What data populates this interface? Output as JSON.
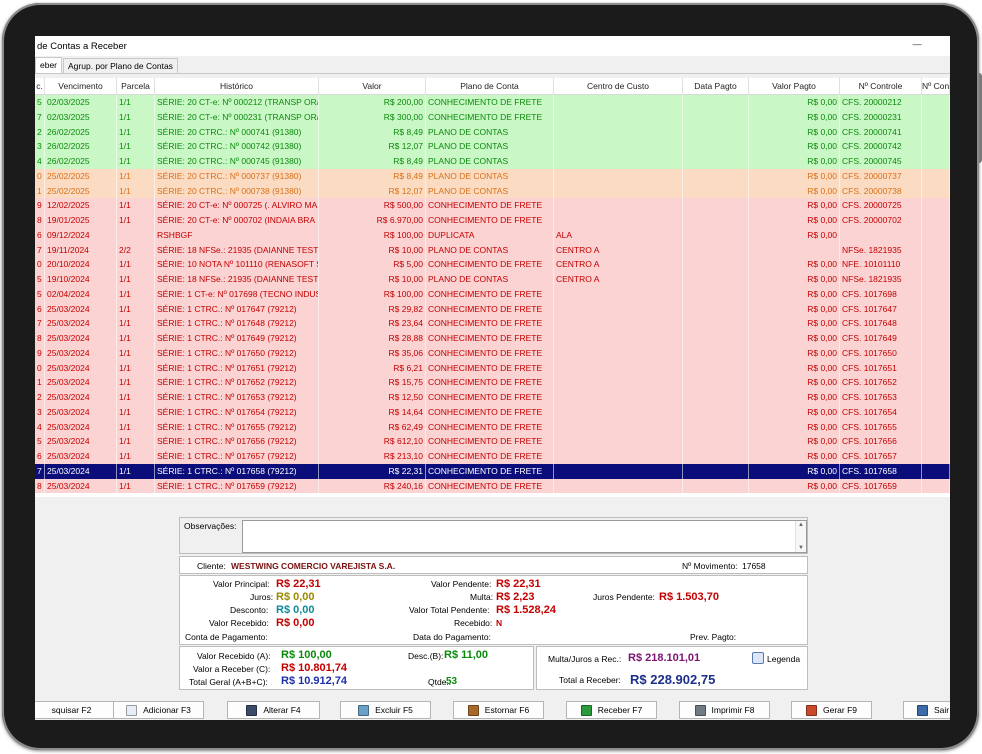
{
  "window": {
    "title": "de Contas a Receber",
    "minimize_glyph": "—"
  },
  "tabs": [
    {
      "label": "eber"
    },
    {
      "label": "Agrup. por Plano de Contas"
    }
  ],
  "columns": [
    "c.",
    "Vencimento",
    "Parcela",
    "Histórico",
    "Valor",
    "Plano de Conta",
    "Centro de Custo",
    "Data Pagto",
    "Valor Pagto",
    "Nº Controle",
    "Nº Contr"
  ],
  "rows": [
    {
      "status": "green",
      "cols": [
        "5",
        "02/03/2025",
        "1/1",
        "SÉRIE: 20 CT-e: Nº 000212 (TRANSP OR/",
        "R$ 200,00",
        "CONHECIMENTO DE FRETE",
        "",
        "",
        "R$ 0,00",
        "CFS. 20000212",
        ""
      ]
    },
    {
      "status": "green",
      "cols": [
        "7",
        "02/03/2025",
        "1/1",
        "SÉRIE: 20 CT-e: Nº 000231 (TRANSP OR/",
        "R$ 300,00",
        "CONHECIMENTO DE FRETE",
        "",
        "",
        "R$ 0,00",
        "CFS. 20000231",
        ""
      ]
    },
    {
      "status": "green",
      "cols": [
        "2",
        "26/02/2025",
        "1/1",
        "SÉRIE: 20 CTRC.: Nº 000741 (91380)",
        "R$ 8,49",
        "PLANO DE CONTAS",
        "",
        "",
        "R$ 0,00",
        "CFS. 20000741",
        ""
      ]
    },
    {
      "status": "green",
      "cols": [
        "3",
        "26/02/2025",
        "1/1",
        "SÉRIE: 20 CTRC.: Nº 000742 (91380)",
        "R$ 12,07",
        "PLANO DE CONTAS",
        "",
        "",
        "R$ 0,00",
        "CFS. 20000742",
        ""
      ]
    },
    {
      "status": "green",
      "cols": [
        "4",
        "26/02/2025",
        "1/1",
        "SÉRIE: 20 CTRC.: Nº 000745 (91380)",
        "R$ 8,49",
        "PLANO DE CONTAS",
        "",
        "",
        "R$ 0,00",
        "CFS. 20000745",
        ""
      ]
    },
    {
      "status": "orange",
      "cols": [
        "0",
        "25/02/2025",
        "1/1",
        "SÉRIE: 20 CTRC.: Nº 000737 (91380)",
        "R$ 8,49",
        "PLANO DE CONTAS",
        "",
        "",
        "R$ 0,00",
        "CFS. 20000737",
        ""
      ]
    },
    {
      "status": "orange",
      "cols": [
        "1",
        "25/02/2025",
        "1/1",
        "SÉRIE: 20 CTRC.: Nº 000738 (91380)",
        "R$ 12,07",
        "PLANO DE CONTAS",
        "",
        "",
        "R$ 0,00",
        "CFS. 20000738",
        ""
      ]
    },
    {
      "status": "red",
      "cols": [
        "9",
        "12/02/2025",
        "1/1",
        "SÉRIE: 20 CT-e: Nº 000725 (. ALVIRO MA",
        "R$ 500,00",
        "CONHECIMENTO DE FRETE",
        "",
        "",
        "R$ 0,00",
        "CFS. 20000725",
        ""
      ]
    },
    {
      "status": "red",
      "cols": [
        "8",
        "19/01/2025",
        "1/1",
        "SÉRIE: 20 CT-e: Nº 000702 (INDAIA BRA",
        "R$ 6.970,00",
        "CONHECIMENTO DE FRETE",
        "",
        "",
        "R$ 0,00",
        "CFS. 20000702",
        ""
      ]
    },
    {
      "status": "red",
      "cols": [
        "6",
        "09/12/2024",
        "",
        "RSHBGF",
        "R$ 100,00",
        "DUPLICATA",
        "ALA",
        "",
        "R$ 0,00",
        "",
        ""
      ]
    },
    {
      "status": "red",
      "cols": [
        "7",
        "19/11/2024",
        "2/2",
        "SÉRIE: 18 NFSe.: 21935 (DAIANNE TESTI",
        "R$ 10,00",
        "PLANO DE CONTAS",
        "CENTRO A",
        "",
        "",
        "NFSe. 1821935",
        ""
      ]
    },
    {
      "status": "red",
      "cols": [
        "0",
        "20/10/2024",
        "1/1",
        "SÉRIE: 10 NOTA Nº 101110 (RENASOFT S",
        "R$ 5,00",
        "CONHECIMENTO DE FRETE",
        "CENTRO A",
        "",
        "R$ 0,00",
        "NFE. 10101110",
        ""
      ]
    },
    {
      "status": "red",
      "cols": [
        "5",
        "19/10/2024",
        "1/1",
        "SÉRIE: 18 NFSe.: 21935 (DAIANNE TESTI",
        "R$ 10,00",
        "PLANO DE CONTAS",
        "CENTRO A",
        "",
        "R$ 0,00",
        "NFSe. 1821935",
        ""
      ]
    },
    {
      "status": "red",
      "cols": [
        "5",
        "02/04/2024",
        "1/1",
        "SÉRIE: 1 CT-e: Nº 017698 (TECNO INDUS",
        "R$ 100,00",
        "CONHECIMENTO DE FRETE",
        "",
        "",
        "R$ 0,00",
        "CFS. 1017698",
        ""
      ]
    },
    {
      "status": "red",
      "cols": [
        "6",
        "25/03/2024",
        "1/1",
        "SÉRIE: 1 CTRC.: Nº 017647 (79212)",
        "R$ 29,82",
        "CONHECIMENTO DE FRETE",
        "",
        "",
        "R$ 0,00",
        "CFS. 1017647",
        ""
      ]
    },
    {
      "status": "red",
      "cols": [
        "7",
        "25/03/2024",
        "1/1",
        "SÉRIE: 1 CTRC.: Nº 017648 (79212)",
        "R$ 23,64",
        "CONHECIMENTO DE FRETE",
        "",
        "",
        "R$ 0,00",
        "CFS. 1017648",
        ""
      ]
    },
    {
      "status": "red",
      "cols": [
        "8",
        "25/03/2024",
        "1/1",
        "SÉRIE: 1 CTRC.: Nº 017649 (79212)",
        "R$ 28,88",
        "CONHECIMENTO DE FRETE",
        "",
        "",
        "R$ 0,00",
        "CFS. 1017649",
        ""
      ]
    },
    {
      "status": "red",
      "cols": [
        "9",
        "25/03/2024",
        "1/1",
        "SÉRIE: 1 CTRC.: Nº 017650 (79212)",
        "R$ 35,06",
        "CONHECIMENTO DE FRETE",
        "",
        "",
        "R$ 0,00",
        "CFS. 1017650",
        ""
      ]
    },
    {
      "status": "red",
      "cols": [
        "0",
        "25/03/2024",
        "1/1",
        "SÉRIE: 1 CTRC.: Nº 017651 (79212)",
        "R$ 6,21",
        "CONHECIMENTO DE FRETE",
        "",
        "",
        "R$ 0,00",
        "CFS. 1017651",
        ""
      ]
    },
    {
      "status": "red",
      "cols": [
        "1",
        "25/03/2024",
        "1/1",
        "SÉRIE: 1 CTRC.: Nº 017652 (79212)",
        "R$ 15,75",
        "CONHECIMENTO DE FRETE",
        "",
        "",
        "R$ 0,00",
        "CFS. 1017652",
        ""
      ]
    },
    {
      "status": "red",
      "cols": [
        "2",
        "25/03/2024",
        "1/1",
        "SÉRIE: 1 CTRC.: Nº 017653 (79212)",
        "R$ 12,50",
        "CONHECIMENTO DE FRETE",
        "",
        "",
        "R$ 0,00",
        "CFS. 1017653",
        ""
      ]
    },
    {
      "status": "red",
      "cols": [
        "3",
        "25/03/2024",
        "1/1",
        "SÉRIE: 1 CTRC.: Nº 017654 (79212)",
        "R$ 14,64",
        "CONHECIMENTO DE FRETE",
        "",
        "",
        "R$ 0,00",
        "CFS. 1017654",
        ""
      ]
    },
    {
      "status": "red",
      "cols": [
        "4",
        "25/03/2024",
        "1/1",
        "SÉRIE: 1 CTRC.: Nº 017655 (79212)",
        "R$ 62,49",
        "CONHECIMENTO DE FRETE",
        "",
        "",
        "R$ 0,00",
        "CFS. 1017655",
        ""
      ]
    },
    {
      "status": "red",
      "cols": [
        "5",
        "25/03/2024",
        "1/1",
        "SÉRIE: 1 CTRC.: Nº 017656 (79212)",
        "R$ 612,10",
        "CONHECIMENTO DE FRETE",
        "",
        "",
        "R$ 0,00",
        "CFS. 1017656",
        ""
      ]
    },
    {
      "status": "red",
      "cols": [
        "6",
        "25/03/2024",
        "1/1",
        "SÉRIE: 1 CTRC.: Nº 017657 (79212)",
        "R$ 213,10",
        "CONHECIMENTO DE FRETE",
        "",
        "",
        "R$ 0,00",
        "CFS. 1017657",
        ""
      ]
    },
    {
      "status": "sel",
      "cols": [
        "7",
        "25/03/2024",
        "1/1",
        "SÉRIE: 1 CTRC.: Nº 017658 (79212)",
        "R$ 22,31",
        "CONHECIMENTO DE FRETE",
        "",
        "",
        "R$ 0,00",
        "CFS. 1017658",
        ""
      ]
    },
    {
      "status": "red",
      "cols": [
        "8",
        "25/03/2024",
        "1/1",
        "SÉRIE: 1 CTRC.: Nº 017659 (79212)",
        "R$ 240,16",
        "CONHECIMENTO DE FRETE",
        "",
        "",
        "R$ 0,00",
        "CFS. 1017659",
        ""
      ]
    }
  ],
  "detail": {
    "obs_label": "Observações:",
    "cliente_label": "Cliente:",
    "cliente": "WESTWING COMERCIO VAREJISTA S.A.",
    "movimento_label": "Nº Movimento:",
    "movimento": "17658",
    "valor_principal_label": "Valor Principal:",
    "valor_principal": "R$ 22,31",
    "juros_label": "Juros:",
    "juros": "R$ 0,00",
    "desconto_label": "Desconto:",
    "desconto": "R$ 0,00",
    "valor_recebido_label": "Valor Recebido:",
    "valor_recebido": "R$ 0,00",
    "conta_pagamento_label": "Conta de Pagamento:",
    "valor_pendente_label": "Valor Pendente:",
    "valor_pendente": "R$ 22,31",
    "multa_label": "Multa:",
    "multa": "R$ 2,23",
    "valor_total_pendente_label": "Valor Total Pendente:",
    "valor_total_pendente": "R$ 1.528,24",
    "recebido_label": "Recebido:",
    "recebido": "N",
    "data_pagamento_label": "Data do Pagamento:",
    "juros_pendente_label": "Juros Pendente:",
    "juros_pendente": "R$ 1.503,70",
    "prev_pagto_label": "Prev. Pagto:"
  },
  "summary": {
    "valor_recebido_label": "Valor Recebido (A):",
    "valor_recebido": "R$ 100,00",
    "valor_receber_label": "Valor a Receber (C):",
    "valor_receber": "R$ 10.801,74",
    "total_geral_label": "Total Geral (A+B+C):",
    "total_geral": "R$ 10.912,74",
    "desc_label": "Desc.(B):",
    "desc": "R$ 11,00",
    "qtde_label": "Qtde.:",
    "qtde": "53",
    "multa_juros_label": "Multa/Juros a Rec.:",
    "multa_juros": "R$ 218.101,01",
    "legenda_label": "Legenda",
    "total_receber_label": "Total a Receber:",
    "total_receber": "R$ 228.902,75"
  },
  "toolbar": [
    {
      "label": "squisar F2",
      "icon": "search-icon",
      "color": "#7a8a9a"
    },
    {
      "label": "Adicionar F3",
      "icon": "new-document-icon",
      "color": "#e8eef8"
    },
    {
      "label": "Alterar F4",
      "icon": "edit-icon",
      "color": "#3a4a6a"
    },
    {
      "label": "Excluir F5",
      "icon": "delete-icon",
      "color": "#6aa0c8"
    },
    {
      "label": "Estornar F6",
      "icon": "reverse-icon",
      "color": "#a8682a"
    },
    {
      "label": "Receber F7",
      "icon": "receive-icon",
      "color": "#2a9a3a"
    },
    {
      "label": "Imprimir F8",
      "icon": "printer-icon",
      "color": "#707a84"
    },
    {
      "label": "Gerar F9",
      "icon": "generate-icon",
      "color": "#c84a2a"
    },
    {
      "label": "Sair",
      "icon": "exit-icon",
      "color": "#3a6aa8"
    }
  ]
}
